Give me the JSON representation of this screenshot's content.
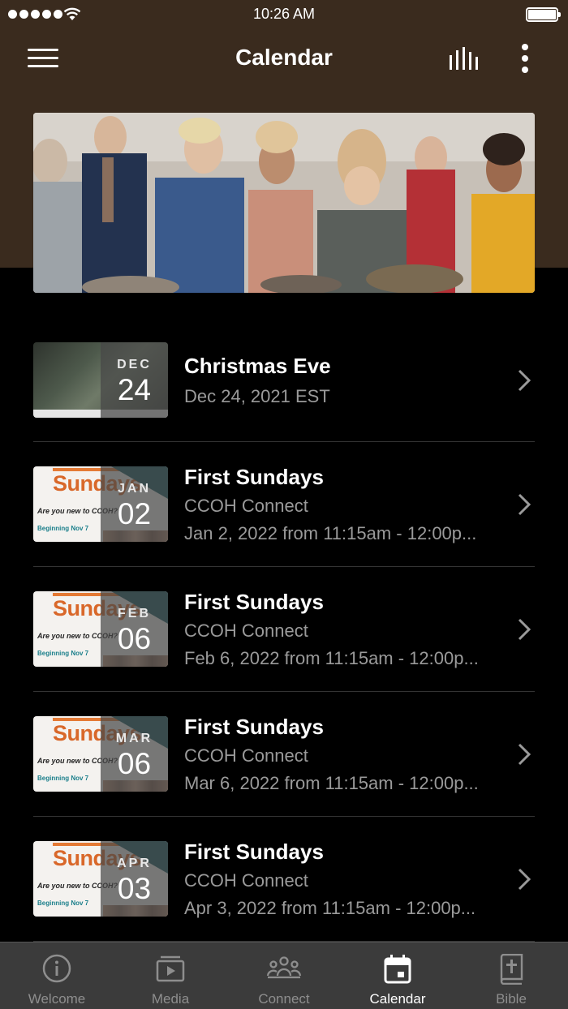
{
  "status_bar": {
    "time": "10:26 AM"
  },
  "header": {
    "title": "Calendar",
    "menu_icon": "hamburger-menu-icon",
    "stats_icon": "bar-chart-icon",
    "more_icon": "more-vertical-icon"
  },
  "colors": {
    "header_bg": "#3a2b1e",
    "tabbar_bg": "#3b3b3b",
    "accent_orange": "#d9682a",
    "teal": "#18575e"
  },
  "events": [
    {
      "title": "Christmas Eve",
      "subtitle": "Dec 24, 2021 EST",
      "detail": "",
      "month": "DEC",
      "day": "24",
      "thumb": "christmas"
    },
    {
      "title": "First Sundays",
      "subtitle": "CCOH Connect",
      "detail": "Jan 2, 2022 from 11:15am - 12:00p...",
      "month": "JAN",
      "day": "02",
      "thumb": "sundays"
    },
    {
      "title": "First Sundays",
      "subtitle": "CCOH Connect",
      "detail": "Feb 6, 2022 from 11:15am - 12:00p...",
      "month": "FEB",
      "day": "06",
      "thumb": "sundays"
    },
    {
      "title": "First Sundays",
      "subtitle": "CCOH Connect",
      "detail": "Mar 6, 2022 from 11:15am - 12:00p...",
      "month": "MAR",
      "day": "06",
      "thumb": "sundays"
    },
    {
      "title": "First Sundays",
      "subtitle": "CCOH Connect",
      "detail": "Apr 3, 2022 from 11:15am - 12:00p...",
      "month": "APR",
      "day": "03",
      "thumb": "sundays"
    }
  ],
  "sundays_thumb": {
    "word": "Sundays",
    "question": "Are you new to CCOH?",
    "beginning": "Beginning Nov 7"
  },
  "tabs": [
    {
      "label": "Welcome",
      "icon": "info-circle-icon",
      "active": false
    },
    {
      "label": "Media",
      "icon": "media-play-icon",
      "active": false
    },
    {
      "label": "Connect",
      "icon": "people-group-icon",
      "active": false
    },
    {
      "label": "Calendar",
      "icon": "calendar-icon",
      "active": true
    },
    {
      "label": "Bible",
      "icon": "bible-icon",
      "active": false
    }
  ]
}
